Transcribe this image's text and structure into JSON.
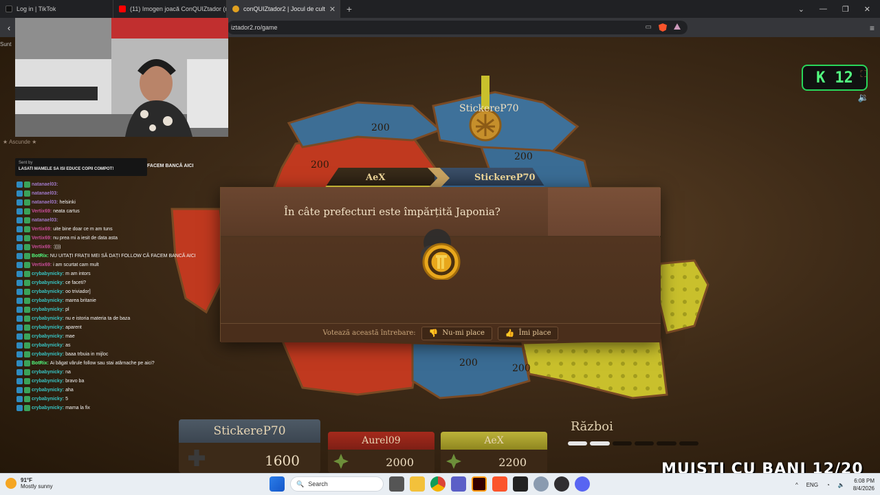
{
  "browser": {
    "tabs": [
      {
        "title": "Log in | TikTok",
        "icon_color": "#111111",
        "active": false
      },
      {
        "title": "(11) Imogen joacă ConQUIZtador (m",
        "icon_color": "#ff0000",
        "active": false
      },
      {
        "title": "conQUIZtador2 | Jocul de cult",
        "icon_color": "#e0a020",
        "active": true
      }
    ],
    "url": "iztador2.ro/game",
    "new_tab": "+"
  },
  "game": {
    "kick_badge": {
      "icon": "K",
      "count": "12"
    },
    "regions": [
      "200",
      "200",
      "200",
      "200",
      "200"
    ],
    "flag_label": "StickereP70",
    "players_bar": {
      "left": "AeX",
      "right": "StickereP70"
    },
    "question": "În câte prefecturi este împărțită Japonia?",
    "vote": {
      "label": "Votează această întrebare:",
      "dislike": "Nu-mi place",
      "like": "Îmi place"
    },
    "scores": [
      {
        "name": "StickereP70",
        "score": "1600"
      },
      {
        "name": "Aurel09",
        "score": "2000"
      },
      {
        "name": "AeX",
        "score": "2200"
      }
    ],
    "war_label": "Război",
    "overlay_text": "MUISTI CU BANI 12/20"
  },
  "stream": {
    "side_text": "Sunt",
    "hide_label": "★ Ascunde ★",
    "pinned_sender": "Sent by",
    "pinned_message": "LASATI MAMELE SA ISI EDUCE COPII COMPOT!",
    "pinned_top_text": "FACEM BANCĂ AICI",
    "chat": [
      {
        "user": "natanael03:",
        "text": "",
        "color": "#a079c8"
      },
      {
        "user": "natanael03:",
        "text": "",
        "color": "#a079c8"
      },
      {
        "user": "natanael03:",
        "text": "helsinki",
        "color": "#a079c8"
      },
      {
        "user": "Vertix69:",
        "text": "neata cartus",
        "color": "#c94d9a"
      },
      {
        "user": "natanael03:",
        "text": "",
        "color": "#a079c8"
      },
      {
        "user": "Vertix69:",
        "text": "uite bine doar ce m am tuns",
        "color": "#c94d9a"
      },
      {
        "user": "Vertix69:",
        "text": "nu prea mi a iesit de data asta",
        "color": "#c94d9a"
      },
      {
        "user": "Vertix69:",
        "text": ":))))",
        "color": "#c94d9a"
      },
      {
        "user": "BotRix:",
        "text": "NU UITAȚI FRAȚII MEI SĂ DAȚI FOLLOW CĂ FACEM BANCĂ AICI",
        "color": "#53ff80"
      },
      {
        "user": "Vertix69:",
        "text": "i am scurtat cam mult",
        "color": "#c94d9a"
      },
      {
        "user": "crybabynicky:",
        "text": "m am intors",
        "color": "#37c4c4"
      },
      {
        "user": "crybabynicky:",
        "text": "ce faceti?",
        "color": "#37c4c4"
      },
      {
        "user": "crybabynicky:",
        "text": "oo triviador]",
        "color": "#37c4c4"
      },
      {
        "user": "crybabynicky:",
        "text": "marea britanie",
        "color": "#37c4c4"
      },
      {
        "user": "crybabynicky:",
        "text": "pl",
        "color": "#37c4c4"
      },
      {
        "user": "crybabynicky:",
        "text": "nu e istoria materia ta de baza",
        "color": "#37c4c4"
      },
      {
        "user": "crybabynicky:",
        "text": "aparent",
        "color": "#37c4c4"
      },
      {
        "user": "crybabynicky:",
        "text": "mae",
        "color": "#37c4c4"
      },
      {
        "user": "crybabynicky:",
        "text": "as",
        "color": "#37c4c4"
      },
      {
        "user": "crybabynicky:",
        "text": "baaa trbuia in mijloc",
        "color": "#37c4c4"
      },
      {
        "user": "BotRix:",
        "text": "Ai băgat vârule follow sau stai atârnache pe aici?",
        "color": "#53ff80"
      },
      {
        "user": "crybabynicky:",
        "text": "na",
        "color": "#37c4c4"
      },
      {
        "user": "crybabynicky:",
        "text": "bravo ba",
        "color": "#37c4c4"
      },
      {
        "user": "crybabynicky:",
        "text": "aha",
        "color": "#37c4c4"
      },
      {
        "user": "crybabynicky:",
        "text": "5",
        "color": "#37c4c4"
      },
      {
        "user": "crybabynicky:",
        "text": "mama la fix",
        "color": "#37c4c4"
      }
    ]
  },
  "taskbar": {
    "temperature": "91°F",
    "weather": "Mostly sunny",
    "search_placeholder": "Search",
    "language": "ENG",
    "time": "6:08 PM",
    "date": "8/4/2026",
    "notif_count": "2"
  }
}
